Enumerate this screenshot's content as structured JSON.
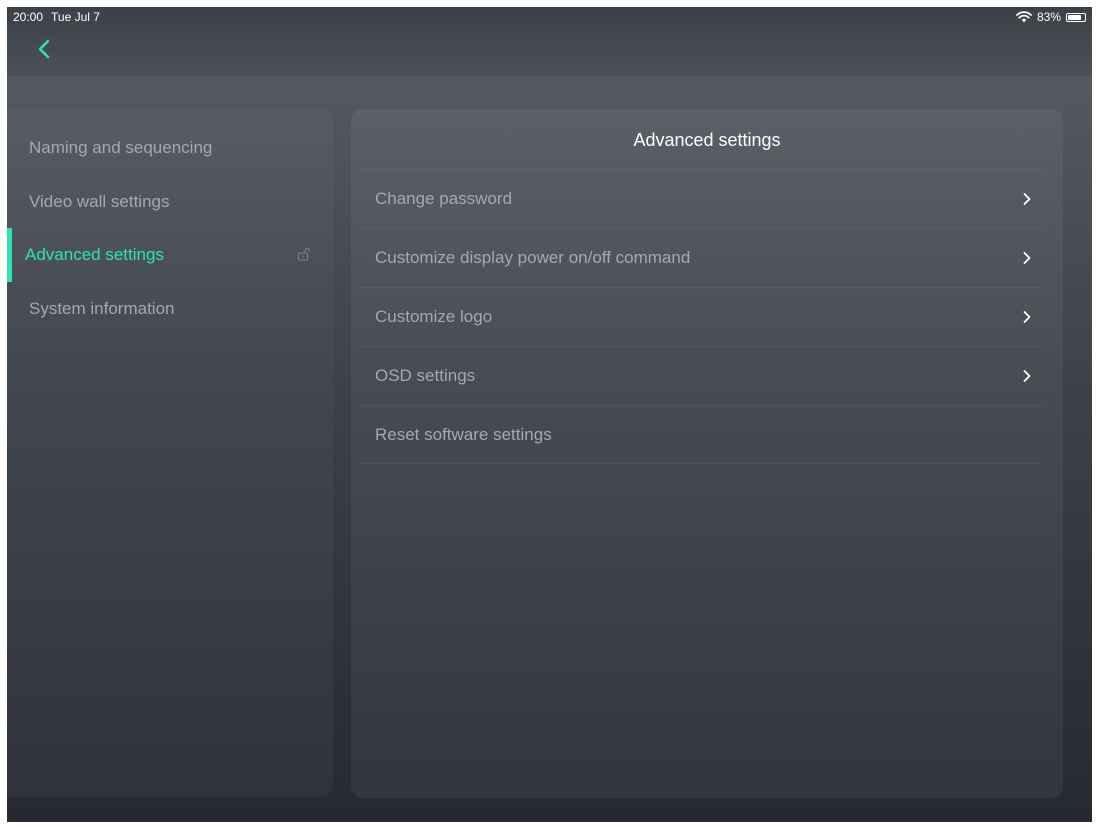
{
  "status_bar": {
    "time": "20:00",
    "date": "Tue Jul 7",
    "battery": "83%"
  },
  "colors": {
    "accent": "#2fe0b9",
    "text_muted": "#a4a9af",
    "title": "#ffffff"
  },
  "sidebar": {
    "items": [
      {
        "label": "Naming and sequencing"
      },
      {
        "label": "Video wall settings"
      },
      {
        "label": "Advanced settings",
        "active": true,
        "icon": "lock-icon"
      },
      {
        "label": "System information"
      }
    ]
  },
  "main": {
    "title": "Advanced settings",
    "rows": [
      {
        "label": "Change password",
        "icon": "chevron-right-icon"
      },
      {
        "label": "Customize display power on/off command",
        "icon": "chevron-right-icon"
      },
      {
        "label": "Customize logo",
        "icon": "chevron-right-icon"
      },
      {
        "label": "OSD settings",
        "icon": "chevron-right-icon"
      },
      {
        "label": "Reset software settings"
      }
    ]
  }
}
